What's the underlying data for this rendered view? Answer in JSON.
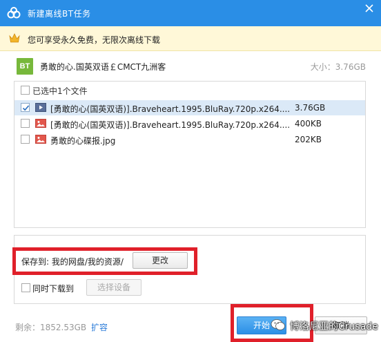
{
  "window": {
    "title": "新建离线BT任务",
    "accent_color": "#2a8ee6",
    "logo_icon": "cloud-icon",
    "close_icon": "close-icon"
  },
  "promo": {
    "icon": "crown-icon",
    "text": "您可享受永久免费，无限次离线下载"
  },
  "task": {
    "icon_label": "BT",
    "name": "勇敢的心.国英双语￡CMCT九洲客",
    "size_text": "大小：3.76GB"
  },
  "file_list": {
    "select_all_label": "已选中1个文件",
    "files": [
      {
        "checked": true,
        "type": "video-icon",
        "name": "[勇敢的心(国英双语)].Braveheart.1995.BluRay.720p.x264....",
        "size": "3.76GB",
        "selected": true
      },
      {
        "checked": false,
        "type": "image-icon",
        "name": "[勇敢的心(国英双语)].Braveheart.1995.BluRay.720p.x264....",
        "size": "400KB",
        "selected": false
      },
      {
        "checked": false,
        "type": "image-icon",
        "name": "勇敢的心碟报.jpg",
        "size": "202KB",
        "selected": false
      }
    ]
  },
  "settings": {
    "save_to_label": "保存到: 我的网盘/我的资源/",
    "change_button": "更改",
    "simultaneous_label": "同时下载到",
    "select_device_button": "选择设备"
  },
  "footer": {
    "remaining_space": "剩余：1852.53GB",
    "expand_link": "扩容",
    "start_button": "开始",
    "cancel_button": "取消"
  },
  "watermark": {
    "text": "博洛尼亚的Crusade"
  }
}
